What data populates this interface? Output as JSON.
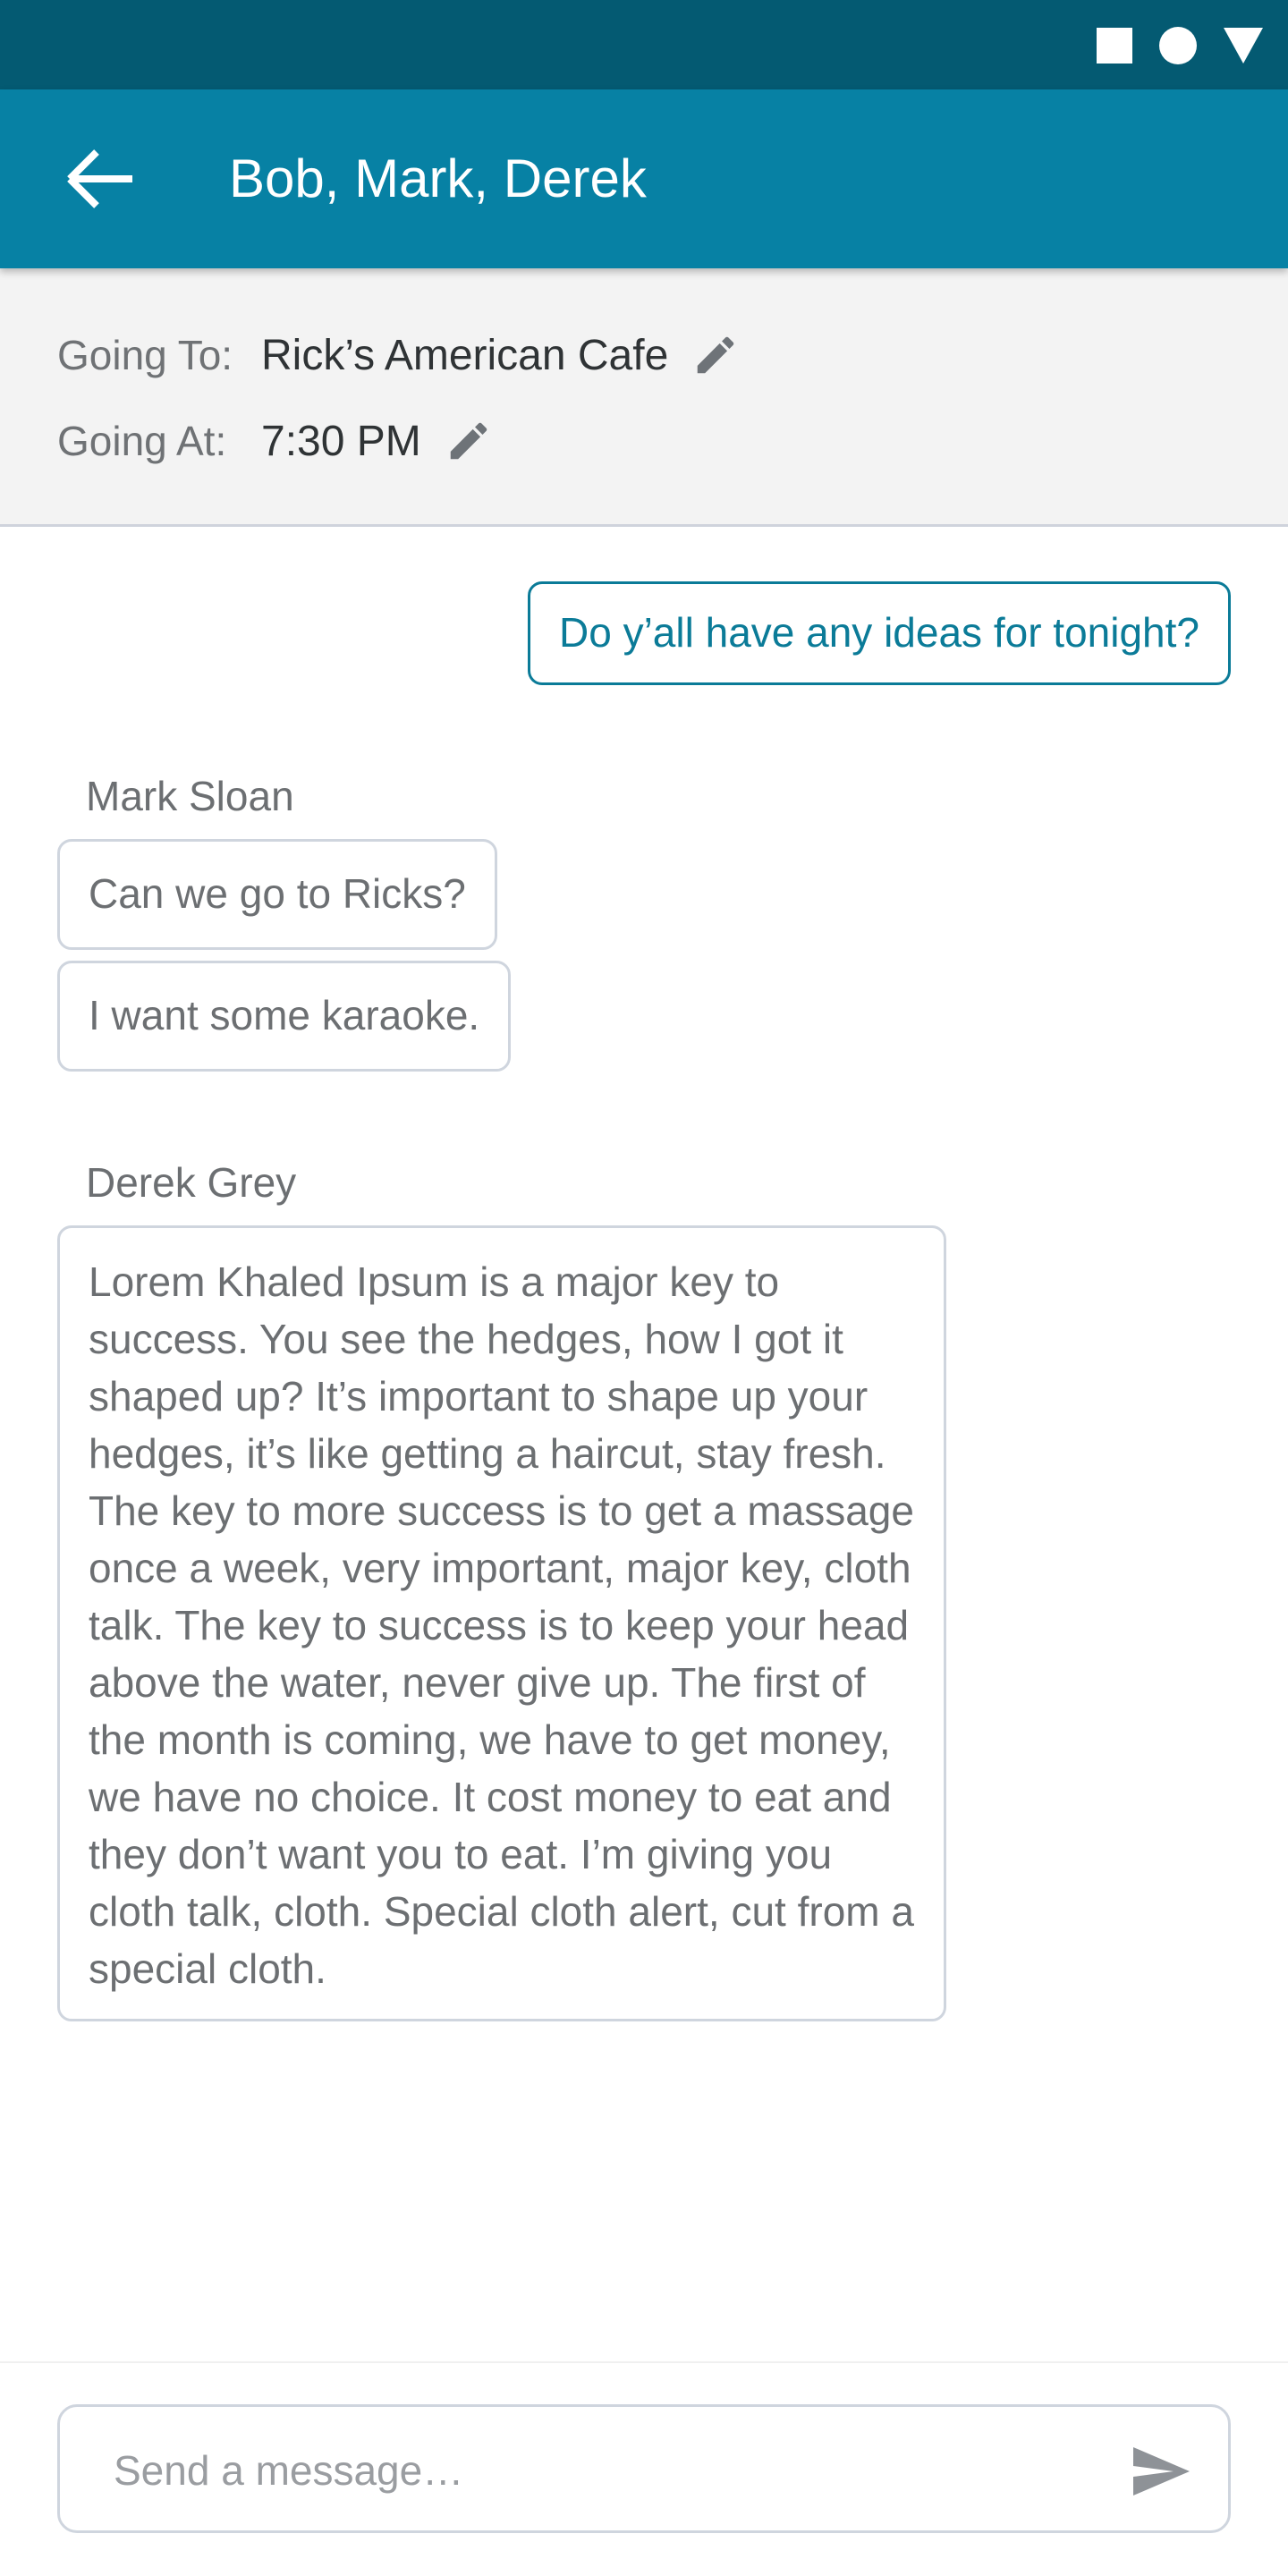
{
  "status_bar": {
    "icons": [
      "square-icon",
      "circle-icon",
      "triangle-icon"
    ],
    "color": "#045a72"
  },
  "app_bar": {
    "title": "Bob, Mark, Derek",
    "back_icon": "arrow-left-icon",
    "color": "#0781a4"
  },
  "plan": {
    "going_to_label": "Going To:",
    "going_to_value": "Rick’s American Cafe",
    "going_at_label": "Going At:",
    "going_at_value": "7:30 PM",
    "edit_icon": "pencil-icon"
  },
  "messages": [
    {
      "from_me": true,
      "text": "Do y’all have any ideas for tonight?"
    },
    {
      "sender": "Mark Sloan",
      "texts": [
        "Can we go to Ricks?",
        "I want some karaoke."
      ]
    },
    {
      "sender": "Derek Grey",
      "texts": [
        "Lorem Khaled Ipsum is a major key to success. You see the hedges, how I got it shaped up? It’s important to shape up your hedges, it’s like getting a haircut, stay fresh. The key to more success is to get a massage once a week, very important, major key, cloth talk. The key to success is to keep your head above the water, never give up. The first of the month is coming, we have to get money, we have no choice. It cost money to eat and they don’t want you to eat. I’m giving you cloth talk, cloth. Special cloth alert, cut from a special cloth."
      ]
    }
  ],
  "composer": {
    "placeholder": "Send a message…",
    "value": "",
    "send_icon": "send-icon"
  },
  "colors": {
    "accent": "#0b7b98",
    "bubble_border": "#cfd5de"
  }
}
